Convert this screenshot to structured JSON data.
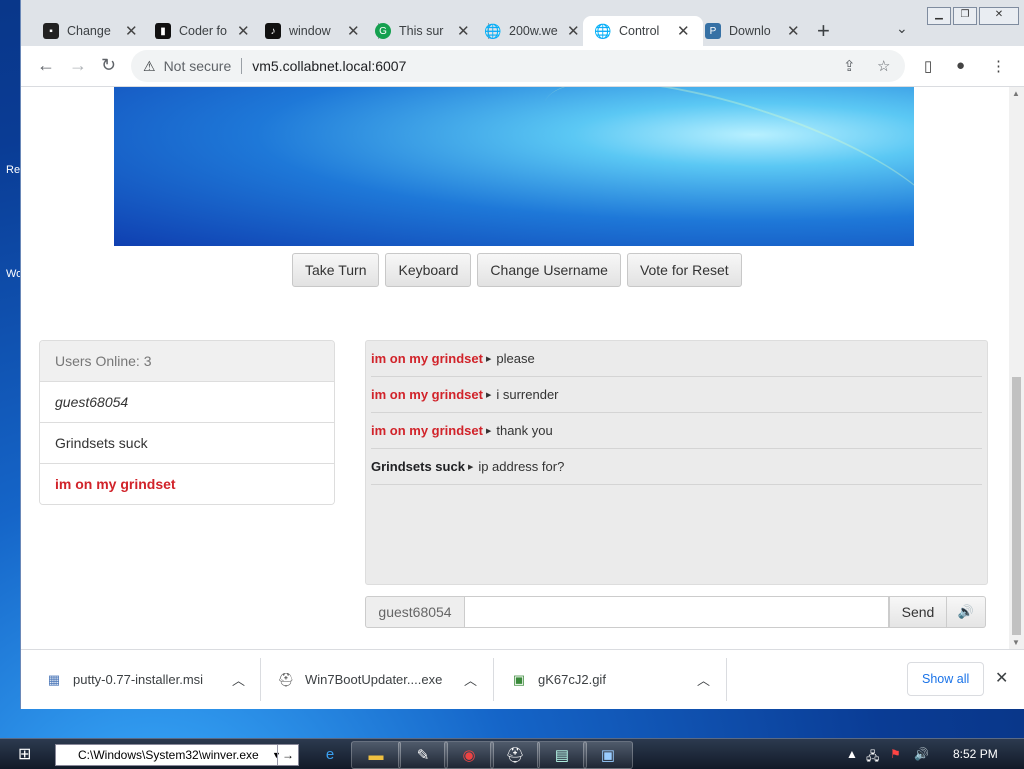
{
  "desktop": {
    "left_labels": [
      "Re",
      "Wo"
    ]
  },
  "tabs": [
    {
      "label": "Change",
      "icon": "terminal-icon",
      "active": false
    },
    {
      "label": "Coder fo",
      "icon": "code-icon",
      "active": false
    },
    {
      "label": "window",
      "icon": "tiktok-icon",
      "active": false
    },
    {
      "label": "This sur",
      "icon": "grammarly-icon",
      "active": false
    },
    {
      "label": "200w.we",
      "icon": "globe-icon",
      "active": false
    },
    {
      "label": "Control",
      "icon": "globe-icon",
      "active": true
    },
    {
      "label": "Downlo",
      "icon": "python-icon",
      "active": false
    }
  ],
  "toolbar": {
    "security_label": "Not secure",
    "url": "vm5.collabnet.local:6007"
  },
  "vm_buttons": {
    "take_turn": "Take Turn",
    "keyboard": "Keyboard",
    "change_username": "Change Username",
    "vote_reset": "Vote for Reset"
  },
  "users": {
    "header": "Users Online: 3",
    "list": [
      "guest68054",
      "Grindsets suck",
      "im on my grindset"
    ]
  },
  "chat": {
    "messages": [
      {
        "user": "im on my grindset",
        "text": "please",
        "highlight": true
      },
      {
        "user": "im on my grindset",
        "text": "i surrender",
        "highlight": true
      },
      {
        "user": "im on my grindset",
        "text": "thank you",
        "highlight": true
      },
      {
        "user": "Grindsets suck",
        "text": "ip address for?",
        "highlight": false
      }
    ]
  },
  "chat_input": {
    "username": "guest68054",
    "value": "",
    "send_label": "Send",
    "sound_icon": "volume-icon"
  },
  "downloads": {
    "items": [
      {
        "name": "putty-0.77-installer.msi",
        "icon": "msi-icon"
      },
      {
        "name": "Win7BootUpdater....exe",
        "icon": "exe-icon"
      },
      {
        "name": "gK67cJ2.gif",
        "icon": "image-icon"
      }
    ],
    "show_all": "Show all"
  },
  "taskbar": {
    "address": "C:\\Windows\\System32\\winver.exe",
    "clock": "8:52 PM"
  },
  "colors": {
    "accent_red": "#d1232a",
    "link_blue": "#1a73e8"
  }
}
